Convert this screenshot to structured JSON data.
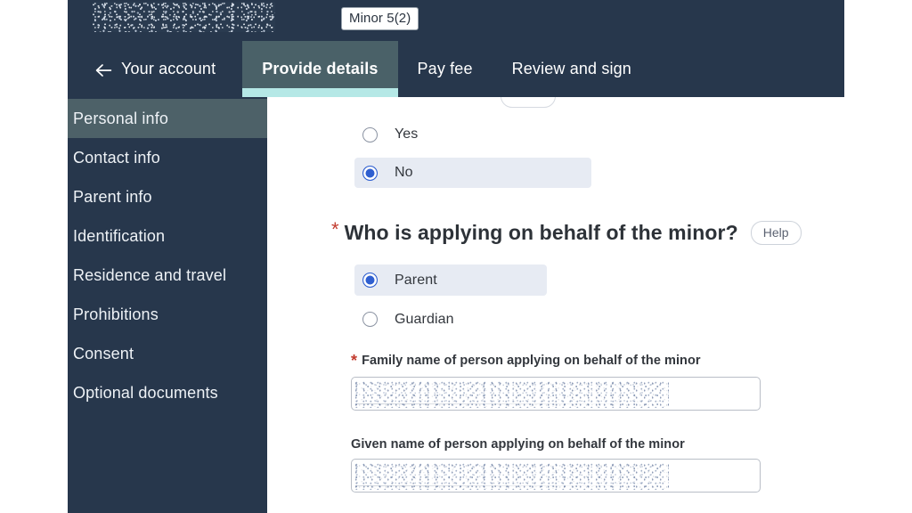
{
  "header": {
    "brand_redacted": "redacted-application-title",
    "document_badge": "Minor 5(2)"
  },
  "tabs": [
    {
      "label": "Your account",
      "icon": "arrow-left-icon",
      "active": false,
      "has_back_arrow": true
    },
    {
      "label": "Provide details",
      "active": true,
      "has_back_arrow": false
    },
    {
      "label": "Pay fee",
      "active": false,
      "has_back_arrow": false
    },
    {
      "label": "Review and sign",
      "active": false,
      "has_back_arrow": false
    }
  ],
  "sidebar": {
    "items": [
      {
        "label": "Personal info",
        "active": true
      },
      {
        "label": "Contact info",
        "active": false
      },
      {
        "label": "Parent info",
        "active": false
      },
      {
        "label": "Identification",
        "active": false
      },
      {
        "label": "Residence and travel",
        "active": false
      },
      {
        "label": "Prohibitions",
        "active": false
      },
      {
        "label": "Consent",
        "active": false
      },
      {
        "label": "Optional documents",
        "active": false
      }
    ]
  },
  "main": {
    "yesno_group": {
      "options": [
        {
          "label": "Yes",
          "selected": false
        },
        {
          "label": "No",
          "selected": true
        }
      ]
    },
    "question": {
      "required_marker": "*",
      "text": "Who is applying on behalf of the minor?",
      "help_label": "Help"
    },
    "applicant_group": {
      "options": [
        {
          "label": "Parent",
          "selected": true
        },
        {
          "label": "Guardian",
          "selected": false
        }
      ]
    },
    "fields": [
      {
        "label": "Family name of person applying on behalf of the minor",
        "required_marker": "*",
        "required": true,
        "value_redacted": "redacted-family-name"
      },
      {
        "label": "Given name of person applying on behalf of the minor",
        "required": false,
        "value_redacted": "redacted-given-name"
      }
    ]
  },
  "colors": {
    "header_navy": "#27374c",
    "tab_active_bg": "#4a6168",
    "tab_active_underline": "#b5e8e6",
    "sidebar_active_bg": "#4d6168",
    "radio_selected_blue": "#2f5fd0",
    "radio_row_selected_bg": "#e7ebf3",
    "required_star_red": "#c23b2e",
    "page_bg": "#ffffff"
  }
}
